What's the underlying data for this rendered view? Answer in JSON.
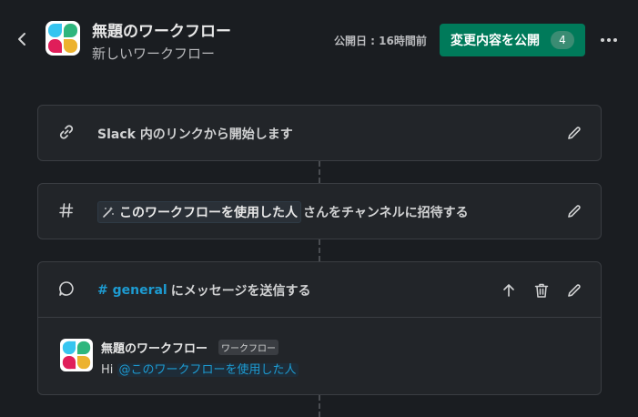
{
  "header": {
    "title": "無題のワークフロー",
    "subtitle": "新しいワークフロー",
    "published_label": "公開日 : 16時間前",
    "publish_button_label": "変更内容を公開",
    "publish_count": "4",
    "icons": {
      "back": "chevron-left-icon",
      "more": "more-horizontal-icon",
      "logo": "slack-logo-icon"
    }
  },
  "steps": [
    {
      "icon": "link-icon",
      "text": "Slack 内のリンクから開始します"
    },
    {
      "icon": "hash-icon",
      "variable": "このワークフローを使用した人",
      "text": "さんをチャンネルに招待する"
    },
    {
      "icon": "message-icon",
      "channel": "# general",
      "text": "にメッセージを送信する"
    }
  ],
  "message_preview": {
    "sender": "無題のワークフロー",
    "badge": "ワークフロー",
    "greeting": "Hi",
    "mention": "@このワークフローを使用した人"
  },
  "colors": {
    "background": "#1a1d21",
    "card": "#222529",
    "accent_green": "#007a5a",
    "link_blue": "#1d9bd1"
  }
}
